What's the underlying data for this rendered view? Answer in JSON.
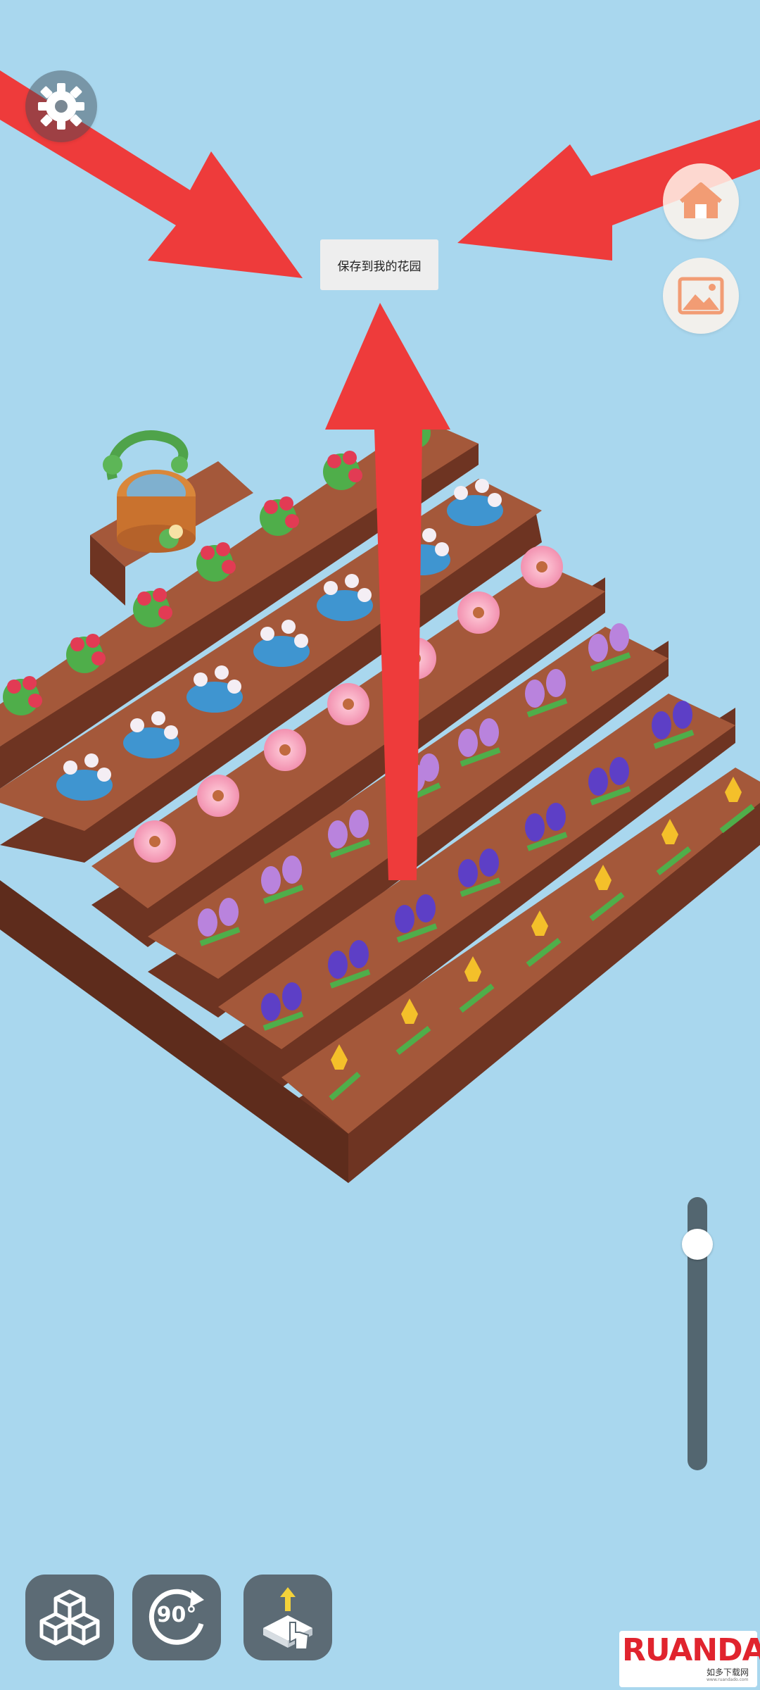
{
  "tooltip": {
    "save_label": "保存到我的花园"
  },
  "top_left": {
    "settings_icon": "gear-icon"
  },
  "top_right": {
    "home_icon": "home-icon",
    "gallery_icon": "image-icon"
  },
  "bottom_bar": {
    "blocks_icon": "cubes-icon",
    "rotate_label": "90°",
    "rotate_icon": "rotate-90-icon",
    "place_icon": "tap-place-icon"
  },
  "zoom_slider": {
    "level": 0.13
  },
  "watermark": {
    "brand": "RUANDADO",
    "subtitle": "如多下载网",
    "url": "www.ruandado.com"
  },
  "colors": {
    "background": "#a9d7ee",
    "soil_top": "#a4583a",
    "soil_side": "#6e3422",
    "arrow": "#ee3b3b",
    "button_bg": "#5c6b75"
  }
}
